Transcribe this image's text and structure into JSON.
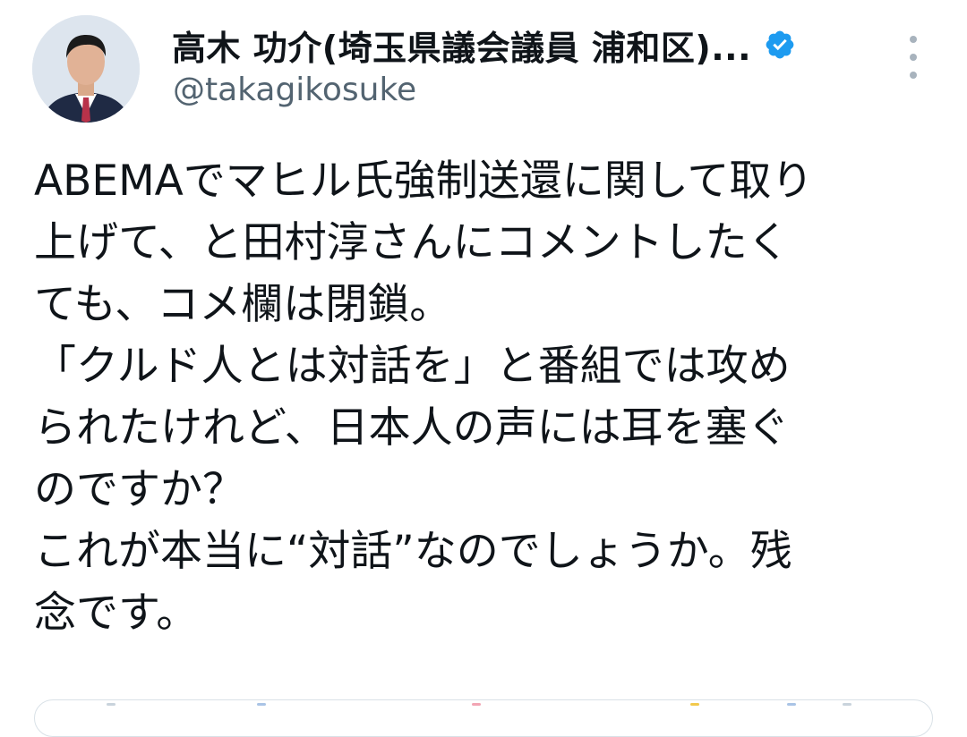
{
  "author": {
    "display_name": "高木 功介(埼玉県議会議員 浦和区)...",
    "handle": "@takagikosuke",
    "verified": true
  },
  "tweet": {
    "lines": [
      "ABEMAでマヒル氏強制送還に関して取り",
      "上げて、と田村淳さんにコメントしたく",
      "ても、コメ欄は閉鎖。",
      "「クルド人とは対話を」と番組では攻め",
      "られたけれど、日本人の声には耳を塞ぐ",
      "のですか？",
      "これが本当に“対話”なのでしょうか。残",
      "念です。"
    ]
  },
  "icons": {
    "verified": "verified-badge-icon",
    "more": "more-options-icon"
  },
  "colors": {
    "text": "#0f1419",
    "secondary": "#536471",
    "verified_blue": "#1d9bf0",
    "divider": "#d9e1e7"
  }
}
